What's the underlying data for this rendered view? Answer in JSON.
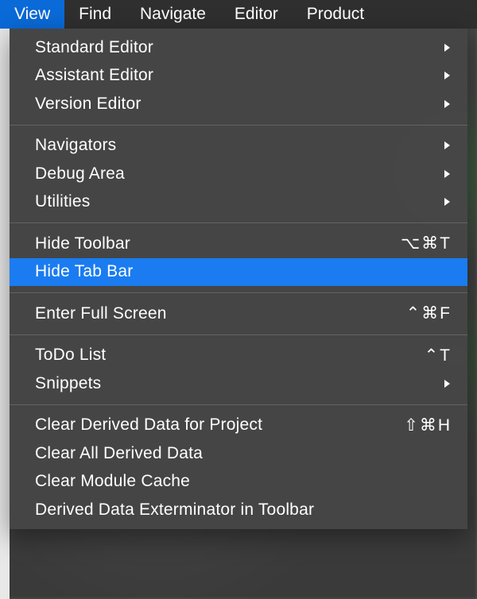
{
  "menubar": {
    "items": [
      "View",
      "Find",
      "Navigate",
      "Editor",
      "Product"
    ],
    "selected_index": 0
  },
  "dropdown": {
    "groups": [
      [
        {
          "id": "standard-editor",
          "label": "Standard Editor",
          "submenu": true
        },
        {
          "id": "assistant-editor",
          "label": "Assistant Editor",
          "submenu": true
        },
        {
          "id": "version-editor",
          "label": "Version Editor",
          "submenu": true
        }
      ],
      [
        {
          "id": "navigators",
          "label": "Navigators",
          "submenu": true
        },
        {
          "id": "debug-area",
          "label": "Debug Area",
          "submenu": true
        },
        {
          "id": "utilities",
          "label": "Utilities",
          "submenu": true
        }
      ],
      [
        {
          "id": "hide-toolbar",
          "label": "Hide Toolbar",
          "shortcut": "⌥⌘T"
        },
        {
          "id": "hide-tab-bar",
          "label": "Hide Tab Bar",
          "highlight": true
        }
      ],
      [
        {
          "id": "enter-full-screen",
          "label": "Enter Full Screen",
          "shortcut": "⌃⌘F"
        }
      ],
      [
        {
          "id": "todo-list",
          "label": "ToDo List",
          "shortcut": "⌃T"
        },
        {
          "id": "snippets",
          "label": "Snippets",
          "submenu": true
        }
      ],
      [
        {
          "id": "clear-derived-data-project",
          "label": "Clear Derived Data for Project",
          "shortcut": "⇧⌘H"
        },
        {
          "id": "clear-all-derived-data",
          "label": "Clear All Derived Data"
        },
        {
          "id": "clear-module-cache",
          "label": "Clear Module Cache"
        },
        {
          "id": "derived-data-exterminator-toolbar",
          "label": "Derived Data Exterminator in Toolbar"
        }
      ]
    ]
  }
}
